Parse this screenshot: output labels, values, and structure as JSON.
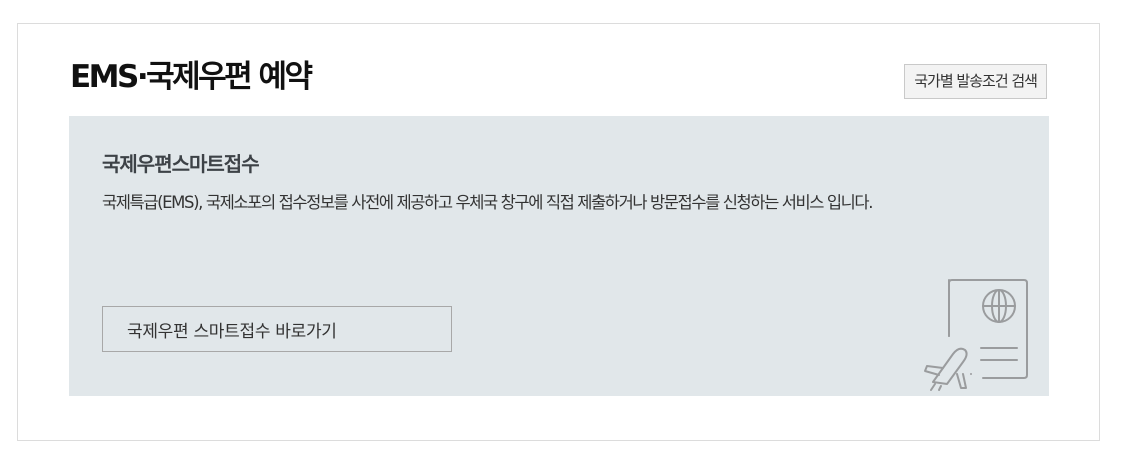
{
  "header": {
    "title": "EMS·국제우편 예약",
    "country_search_label": "국가별 발송조건 검색"
  },
  "smart_intake": {
    "heading": "국제우편스마트접수",
    "description": "국제특급(EMS), 국제소포의 접수정보를 사전에 제공하고 우체국 창구에 직접 제출하거나 방문접수를 신청하는 서비스 입니다.",
    "button_label": "국제우편 스마트접수 바로가기",
    "icon": "passport-airplane-icon"
  },
  "colors": {
    "panel_background": "#e1e7ea",
    "icon_stroke": "#9a9c9e",
    "card_border": "#dcdcdc"
  }
}
